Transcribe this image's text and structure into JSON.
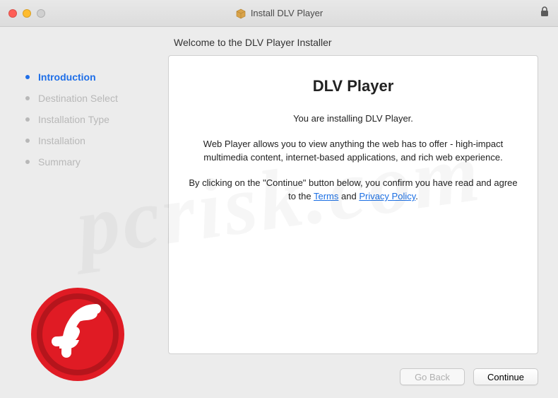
{
  "window": {
    "title": "Install DLV Player"
  },
  "subtitle": "Welcome to the DLV Player Installer",
  "sidebar": {
    "steps": [
      {
        "label": "Introduction",
        "active": true
      },
      {
        "label": "Destination Select",
        "active": false
      },
      {
        "label": "Installation Type",
        "active": false
      },
      {
        "label": "Installation",
        "active": false
      },
      {
        "label": "Summary",
        "active": false
      }
    ]
  },
  "panel": {
    "heading": "DLV Player",
    "line1": "You are installing DLV Player.",
    "line2": "Web Player allows you to view anything the web has to offer - high-impact multimedia content, internet-based applications, and rich web experience.",
    "consent_prefix": "By clicking on the \"Continue\" button below, you confirm you have read and agree to the ",
    "terms_label": "Terms",
    "and_label": " and ",
    "privacy_label": "Privacy Policy",
    "consent_suffix": "."
  },
  "buttons": {
    "back": "Go Back",
    "continue": "Continue"
  },
  "watermark": "pcrisk.com"
}
